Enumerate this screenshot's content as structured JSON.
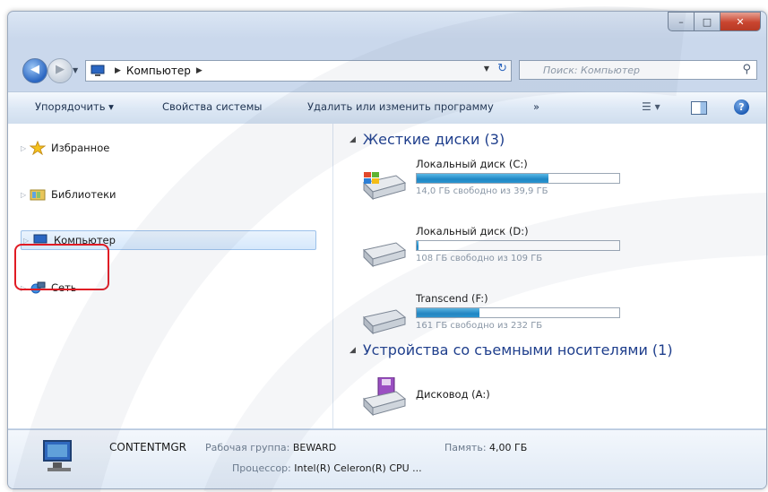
{
  "window": {
    "controls": {
      "minimize": "–",
      "maximize": "□",
      "close": "✕"
    }
  },
  "address": {
    "path": [
      "Компьютер"
    ],
    "search_placeholder": "Поиск: Компьютер",
    "icons": [
      "back-arrow-icon",
      "forward-arrow-icon",
      "computer-icon",
      "refresh-icon",
      "search-icon"
    ]
  },
  "toolbar": {
    "organize": "Упорядочить ▾",
    "system_properties": "Свойства системы",
    "uninstall": "Удалить или изменить программу",
    "more": "»"
  },
  "nav": {
    "items": [
      {
        "label": "Избранное",
        "icon": "star-icon"
      },
      {
        "label": "Библиотеки",
        "icon": "library-icon"
      },
      {
        "label": "Компьютер",
        "icon": "computer-icon",
        "selected": true
      },
      {
        "label": "Сеть",
        "icon": "network-icon",
        "highlighted": true
      }
    ],
    "highlight_color": "#e01b24"
  },
  "content": {
    "hdd_group": "Жесткие диски (3)",
    "removable_group": "Устройства со съемными носителями (1)",
    "drives": [
      {
        "name": "Локальный диск (C:)",
        "free_text": "14,0 ГБ свободно из 39,9 ГБ",
        "used_fraction": 0.65
      },
      {
        "name": "Локальный диск (D:)",
        "free_text": "108 ГБ свободно из 109 ГБ",
        "used_fraction": 0.01
      },
      {
        "name": "Transcend (F:)",
        "free_text": "161 ГБ свободно из 232 ГБ",
        "used_fraction": 0.31
      }
    ],
    "removable": [
      {
        "name": "Дисковод (A:)",
        "icon": "floppy-drive-icon"
      }
    ],
    "bar_color": "#1f86c4"
  },
  "details": {
    "computer_name": "CONTENTMGR",
    "workgroup_label": "Рабочая группа:",
    "workgroup_value": "BEWARD",
    "memory_label": "Память:",
    "memory_value": "4,00 ГБ",
    "cpu_label": "Процессор:",
    "cpu_value": "Intel(R) Celeron(R) CPU ..."
  }
}
